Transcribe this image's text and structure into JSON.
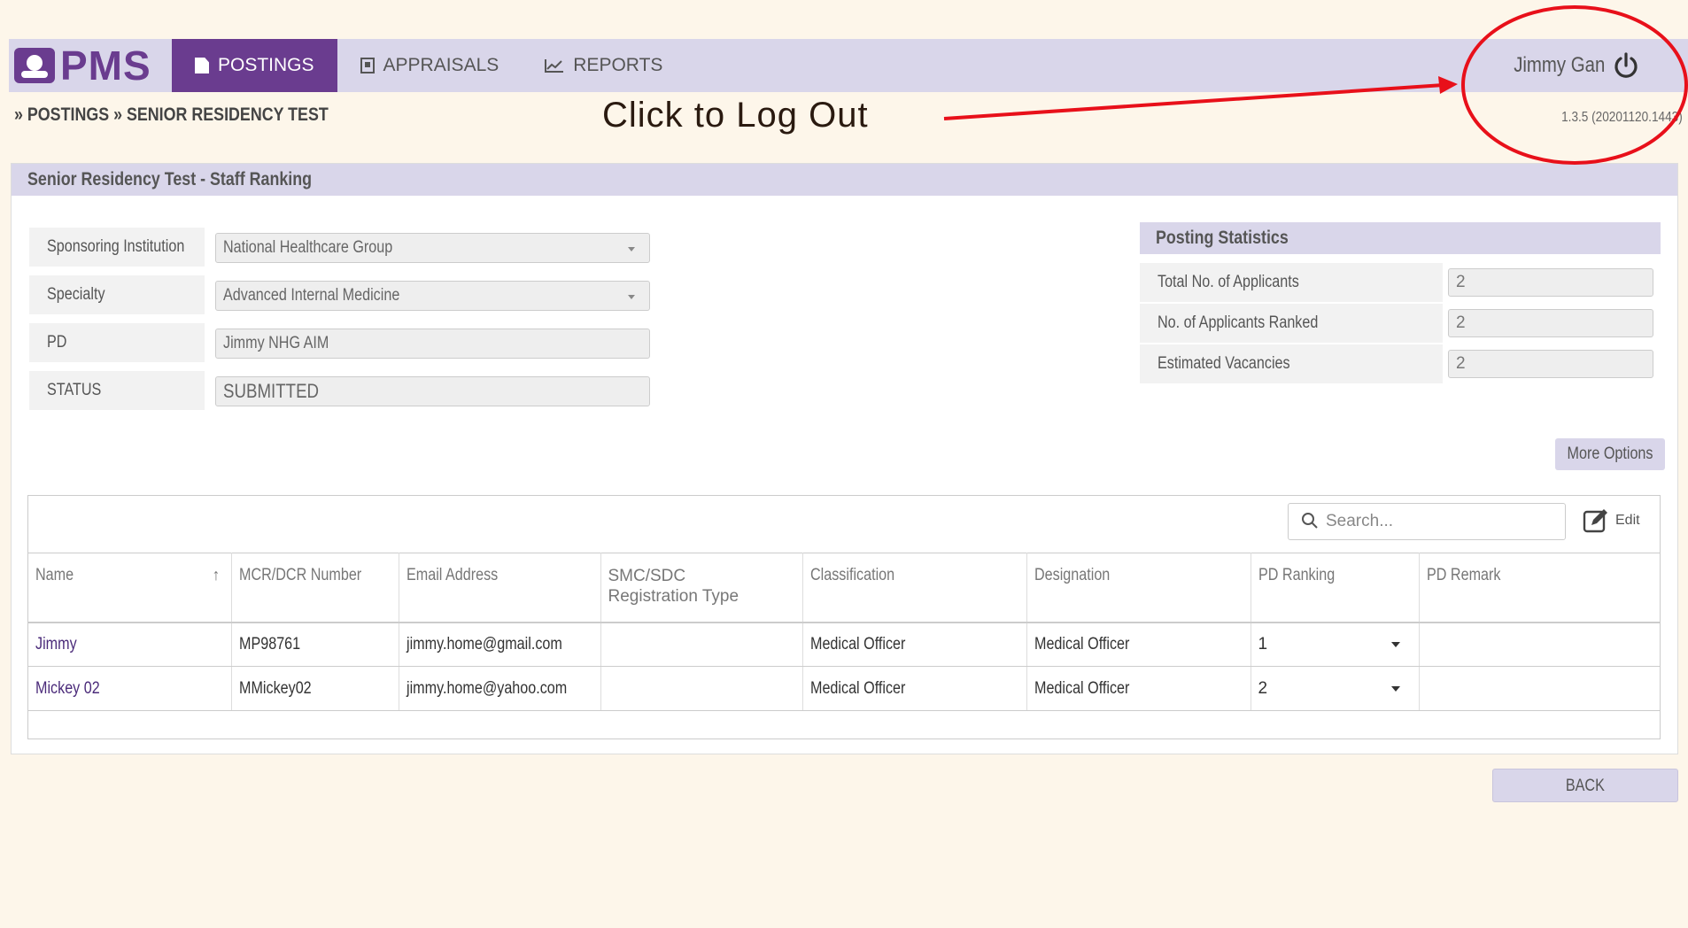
{
  "app": {
    "logo_text": "PMS"
  },
  "nav": {
    "items": [
      {
        "label": "POSTINGS",
        "icon": "document-icon",
        "active": true
      },
      {
        "label": "APPRAISALS",
        "icon": "appraisal-book-icon",
        "active": false
      },
      {
        "label": "REPORTS",
        "icon": "line-chart-icon",
        "active": false
      }
    ]
  },
  "user": {
    "name": "Jimmy Gan",
    "logout_icon": "power-icon"
  },
  "breadcrumb": "» POSTINGS » SENIOR RESIDENCY TEST",
  "version": "1.3.5 (20201120.1443)",
  "annotation": {
    "text": "Click to Log Out",
    "color": "#e8101a"
  },
  "panel": {
    "title": "Senior Residency Test - Staff Ranking",
    "fields": [
      {
        "label": "Sponsoring Institution",
        "value": "National Healthcare Group",
        "dropdown": true
      },
      {
        "label": "Specialty",
        "value": "Advanced Internal Medicine",
        "dropdown": true
      },
      {
        "label": "PD",
        "value": "Jimmy NHG AIM",
        "dropdown": false
      },
      {
        "label": "STATUS",
        "value": "SUBMITTED",
        "dropdown": false
      }
    ],
    "stats": {
      "title": "Posting Statistics",
      "rows": [
        {
          "label": "Total No. of Applicants",
          "value": "2"
        },
        {
          "label": "No. of Applicants Ranked",
          "value": "2"
        },
        {
          "label": "Estimated Vacancies",
          "value": "2"
        }
      ]
    },
    "more_options_label": "More Options"
  },
  "table": {
    "search_placeholder": "Search...",
    "edit_label": "Edit",
    "columns": [
      "Name",
      "MCR/DCR Number",
      "Email Address",
      "SMC/SDC Registration Type",
      "Classification",
      "Designation",
      "PD Ranking",
      "PD Remark"
    ],
    "sort_indicator": "↑",
    "rows": [
      {
        "name": "Jimmy",
        "mcr": "MP98761",
        "email": "jimmy.home@gmail.com",
        "smc": "",
        "classification": "Medical Officer",
        "designation": "Medical Officer",
        "ranking": "1",
        "remark": ""
      },
      {
        "name": "Mickey 02",
        "mcr": "MMickey02",
        "email": "jimmy.home@yahoo.com",
        "smc": "",
        "classification": "Medical Officer",
        "designation": "Medical Officer",
        "ranking": "2",
        "remark": ""
      }
    ]
  },
  "back_label": "BACK",
  "colors": {
    "accent": "#6a3c8f",
    "header_bg": "#d9d6ea",
    "page_bg": "#fdf6ea"
  }
}
